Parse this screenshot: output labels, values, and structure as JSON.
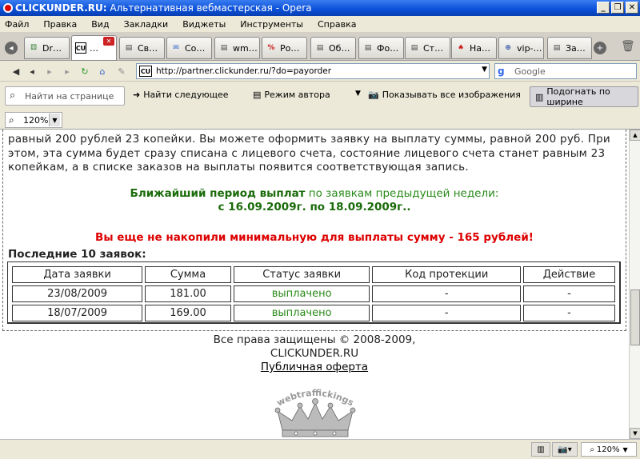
{
  "window": {
    "title_bold": "CLICKUNDER.RU:",
    "title_rest": " Альтернативная вебмастерская - Opera",
    "min_label": "_",
    "max_label": "❐",
    "close_label": "✕"
  },
  "menu": [
    "Файл",
    "Правка",
    "Вид",
    "Закладки",
    "Виджеты",
    "Инструменты",
    "Справка"
  ],
  "tabs": [
    {
      "label": "Dr…",
      "icon": "⚄",
      "color": "#2a7a2a"
    },
    {
      "label": "…",
      "icon": "CU",
      "color": "#000"
    },
    {
      "label": "Св…",
      "icon": "▤",
      "color": "#444"
    },
    {
      "label": "Co…",
      "icon": "✉",
      "color": "#3366cc"
    },
    {
      "label": "wm…",
      "icon": "▤",
      "color": "#444"
    },
    {
      "label": "Ро…",
      "icon": "%",
      "color": "#cc2222"
    },
    {
      "label": "Об…",
      "icon": "▤",
      "color": "#444"
    },
    {
      "label": "Фо…",
      "icon": "▤",
      "color": "#444"
    },
    {
      "label": "Ст…",
      "icon": "▤",
      "color": "#444"
    },
    {
      "label": "На…",
      "icon": "♠",
      "color": "#cc2222"
    },
    {
      "label": "vip-…",
      "icon": "⊕",
      "color": "#3355aa"
    },
    {
      "label": "За…",
      "icon": "▤",
      "color": "#444"
    }
  ],
  "tab_close": "✕",
  "address": {
    "url": "http://partner.clickunder.ru/?do=payorder",
    "favicon": "CU",
    "search_placeholder": "Google",
    "search_logo": "g"
  },
  "toolbar": {
    "find_placeholder": "Найти на странице",
    "find_next": "Найти следующее",
    "author_mode": "Режим автора",
    "show_images": "Показывать все изображения",
    "fit_width": "Подогнать по ширине",
    "zoom": "120%"
  },
  "page": {
    "para": "равный 200 рублей 23 копейки. Вы можете оформить заявку на выплату суммы, равной 200 руб. При этом, эта сумма будет сразу списана с лицевого счета, состояние лицевого счета станет равным 23 копейкам, а в списке заказов на выплаты появится соответствующая запись.",
    "period_bold": "Ближайший период выплат",
    "period_rest": " по заявкам предыдущей недели:",
    "period_dates": "с 16.09.2009г. по 18.09.2009г..",
    "warning": "Вы еще не накопили минимальную для выплаты сумму - 165 рублей!",
    "last10": "Последние 10 заявок:",
    "table": {
      "headers": [
        "Дата заявки",
        "Сумма",
        "Статус заявки",
        "Код протекции",
        "Действие"
      ],
      "rows": [
        [
          "23/08/2009",
          "181.00",
          "выплачено",
          "-",
          "-"
        ],
        [
          "18/07/2009",
          "169.00",
          "выплачено",
          "-",
          "-"
        ]
      ]
    },
    "footer_copy": "Все права защищены © 2008-2009,",
    "footer_site": "CLICKUNDER.RU",
    "footer_link": "Публичная оферта",
    "logo_text": "webtraffickings"
  },
  "statusbar": {
    "zoom": "120%"
  }
}
